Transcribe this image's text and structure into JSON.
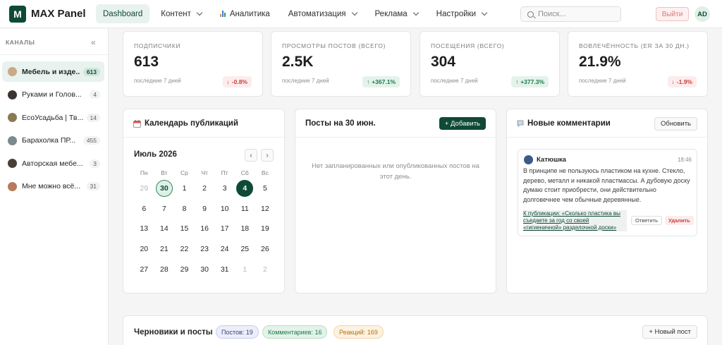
{
  "app": {
    "logo_letter": "M",
    "name": "MAX Panel"
  },
  "nav": [
    {
      "label": "Dashboard",
      "active": true,
      "dropdown": false
    },
    {
      "label": "Контент",
      "active": false,
      "dropdown": true
    },
    {
      "label": "Аналитика",
      "active": false,
      "dropdown": false,
      "icon": "bar-chart-icon"
    },
    {
      "label": "Автоматизация",
      "active": false,
      "dropdown": true
    },
    {
      "label": "Реклама",
      "active": false,
      "dropdown": true
    },
    {
      "label": "Настройки",
      "active": false,
      "dropdown": true
    }
  ],
  "search": {
    "placeholder": "Поиск..."
  },
  "header": {
    "logout_label": "Выйти",
    "avatar_initials": "AD"
  },
  "sidebar": {
    "heading": "КАНАЛЫ",
    "collapse_glyph": "«",
    "channels": [
      {
        "name": "Мебель и изде...",
        "count": "613",
        "color": "#c9a98a",
        "active": true
      },
      {
        "name": "Руками и Голов...",
        "count": "4",
        "color": "#3b3430"
      },
      {
        "name": "ЕсоУсадьба | Тв...",
        "count": "14",
        "color": "#8a7a52"
      },
      {
        "name": "Барахолка ПР...",
        "count": "455",
        "color": "#7a8a90"
      },
      {
        "name": "Авторская мебе...",
        "count": "3",
        "color": "#4a3f36"
      },
      {
        "name": "Мне можно всё...",
        "count": "31",
        "color": "#b87a5a"
      }
    ]
  },
  "stats": [
    {
      "label": "ПОДПИСЧИКИ",
      "value": "613",
      "sub": "последние 7 дней",
      "change": "-0.8%",
      "trend": "down"
    },
    {
      "label": "ПРОСМОТРЫ ПОСТОВ (ВСЕГО)",
      "value": "2.5K",
      "sub": "последние 7 дней",
      "change": "+367.1%",
      "trend": "up"
    },
    {
      "label": "ПОСЕЩЕНИЯ (ВСЕГО)",
      "value": "304",
      "sub": "последние 7 дней",
      "change": "+377.3%",
      "trend": "up"
    },
    {
      "label": "ВОВЛЕЧЁННОСТЬ (ER ЗА 30 ДН.)",
      "value": "21.9%",
      "sub": "последние 7 дней",
      "change": "-1.9%",
      "trend": "down"
    }
  ],
  "calendar": {
    "title": "Календарь публикаций",
    "month": "Июль 2026",
    "prev_glyph": "‹",
    "next_glyph": "›",
    "weekdays": [
      "Пн",
      "Вт",
      "Ср",
      "Чт",
      "Пт",
      "Сб",
      "Вс"
    ],
    "weeks": [
      [
        "29",
        "30",
        "1",
        "2",
        "3",
        "4",
        "5"
      ],
      [
        "6",
        "7",
        "8",
        "9",
        "10",
        "11",
        "12"
      ],
      [
        "13",
        "14",
        "15",
        "16",
        "17",
        "18",
        "19"
      ],
      [
        "20",
        "21",
        "22",
        "23",
        "24",
        "25",
        "26"
      ],
      [
        "27",
        "28",
        "29",
        "30",
        "31",
        "1",
        "2"
      ]
    ],
    "muted_cells": [
      "0-0",
      "4-5",
      "4-6"
    ],
    "today_cell": "0-1",
    "selected_cell": "0-5"
  },
  "posts": {
    "title": "Посты на 30 июн.",
    "add_label": "+ Добавить",
    "empty_text": "Нет запланированных или опубликованных постов на этот день."
  },
  "comments": {
    "title": "Новые комментарии",
    "refresh_label": "Обновить",
    "items": [
      {
        "author": "Катюшка",
        "time": "18:46",
        "text": "В принципе не пользуюсь пластиком на кухне. Стекло, дерево, металл и никакой пластмассы. А дубовую доску думаю стоит приобрести, они действительно долговечнее чем обычные деревянные.",
        "link": "К публикации: «Сколько пластика вы съедаете за год со своей «гигиеничной» разделочной доски»",
        "reply_label": "Ответить",
        "delete_label": "Удалить"
      }
    ]
  },
  "drafts": {
    "title": "Черновики и посты",
    "pills": [
      "Постов: 19",
      "Комментариев: 16",
      "Реакций: 169"
    ],
    "new_post_label": "+ Новый пост"
  }
}
